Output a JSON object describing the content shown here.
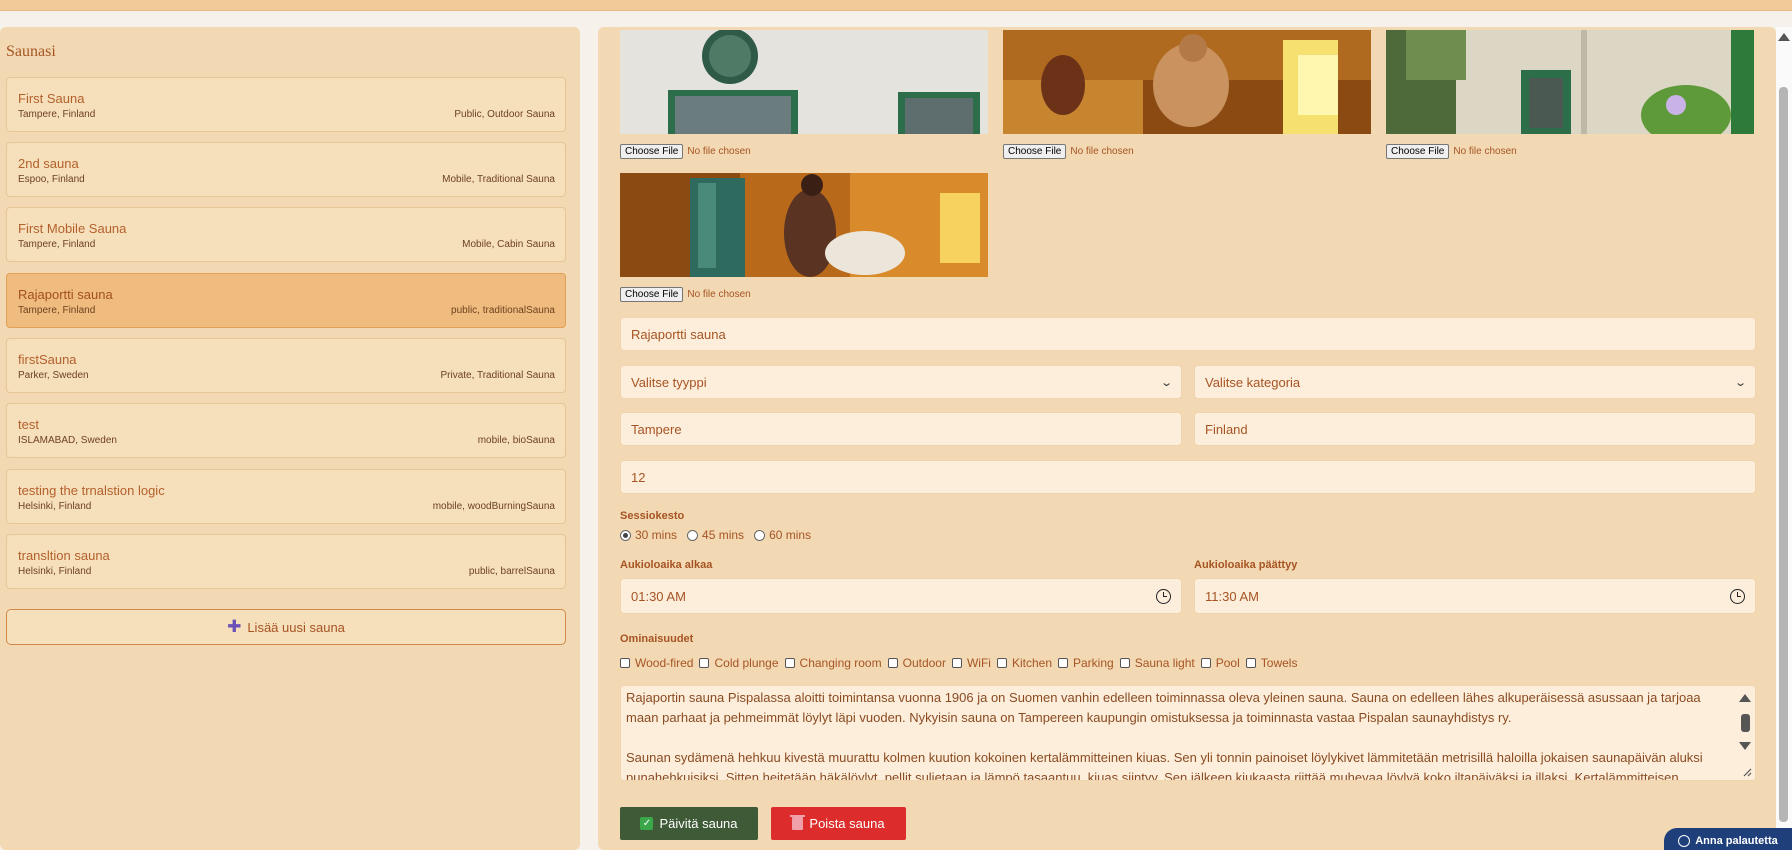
{
  "sidebar": {
    "title": "Saunasi",
    "items": [
      {
        "name": "First Sauna",
        "location": "Tampere, Finland",
        "category": "Public, Outdoor Sauna"
      },
      {
        "name": "2nd sauna",
        "location": "Espoo, Finland",
        "category": "Mobile, Traditional Sauna"
      },
      {
        "name": "First Mobile Sauna",
        "location": "Tampere, Finland",
        "category": "Mobile, Cabin Sauna"
      },
      {
        "name": "Rajaportti sauna",
        "location": "Tampere, Finland",
        "category": "public, traditionalSauna"
      },
      {
        "name": "firstSauna",
        "location": "Parker, Sweden",
        "category": "Private, Traditional Sauna"
      },
      {
        "name": "test",
        "location": "ISLAMABAD, Sweden",
        "category": "mobile, bioSauna"
      },
      {
        "name": "testing the trnalstion logic",
        "location": "Helsinki, Finland",
        "category": "mobile, woodBurningSauna"
      },
      {
        "name": "transltion sauna",
        "location": "Helsinki, Finland",
        "category": "public, barrelSauna"
      }
    ],
    "active_index": 3,
    "add_label": "Lisää uusi sauna"
  },
  "photos": {
    "choose_file_label": "Choose File",
    "no_file_label": "No file chosen"
  },
  "form": {
    "name_value": "Rajaportti sauna",
    "type_select": "Valitse tyyppi",
    "category_select": "Valitse kategoria",
    "city_value": "Tampere",
    "country_value": "Finland",
    "capacity_value": "12",
    "session_label": "Sessiokesto",
    "session_options": [
      "30 mins",
      "45 mins",
      "60 mins"
    ],
    "session_selected": 0,
    "open_label": "Aukioloaika alkaa",
    "open_value": "01:30 AM",
    "close_label": "Aukioloaika päättyy",
    "close_value": "11:30 AM",
    "features_label": "Ominaisuudet",
    "features": [
      "Wood-fired",
      "Cold plunge",
      "Changing room",
      "Outdoor",
      "WiFi",
      "Kitchen",
      "Parking",
      "Sauna light",
      "Pool",
      "Towels"
    ],
    "description_p1": "Rajaportin sauna Pispalassa aloitti toimintansa vuonna 1906 ja on Suomen vanhin edelleen toiminnassa oleva yleinen sauna. Sauna on edelleen lähes alkuperäisessä asussaan ja tarjoaa maan parhaat ja pehmeimmät löylyt läpi vuoden. Nykyisin sauna on Tampereen kaupungin omistuksessa ja toiminnasta vastaa Pispalan saunayhdistys ry.",
    "description_p2": "Saunan sydämenä hehkuu kivestä muurattu kolmen kuution kokoinen kertalämmitteinen kiuas. Sen yli tonnin painoiset löylykivet lämmitetään metrisillä haloilla jokaisen saunapäivän aluksi punahehkuisiksi. Sitten heitetään häkälöylyt, pellit suljetaan ja lämpö tasaantuu, kiuas siintyy. Sen jälkeen kiukaasta riittää muhevaa löylyä koko iltapäiväksi ja illaksi. Kertalämmitteisen",
    "update_label": "Päivitä sauna",
    "delete_label": "Poista sauna"
  },
  "feedback_label": "Anna palautetta",
  "colors": {
    "accent": "#a65423",
    "panel": "#f2d9b3",
    "active_item": "#efbb7e",
    "update_button": "#3e5a36",
    "delete_button": "#dc2c2c"
  }
}
